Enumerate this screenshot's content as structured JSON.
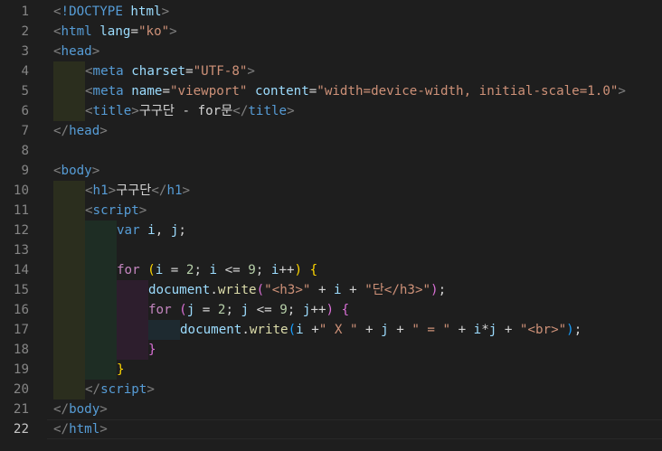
{
  "editor": {
    "colors": {
      "background": "#1e1e1e",
      "guide_level1": "#2b2e1e",
      "guide_level2": "#1e2d24",
      "guide_level3": "#2d1e2d",
      "guide_level4": "#1e2a30"
    },
    "current_line": 22,
    "lines": [
      {
        "n": "1",
        "indent": [],
        "tokens": [
          [
            "bracket",
            "<"
          ],
          [
            "doctype",
            "!DOCTYPE "
          ],
          [
            "attr",
            "html"
          ],
          [
            "bracket",
            ">"
          ]
        ]
      },
      {
        "n": "2",
        "indent": [],
        "tokens": [
          [
            "bracket",
            "<"
          ],
          [
            "tag",
            "html "
          ],
          [
            "attr",
            "lang"
          ],
          [
            "text",
            "="
          ],
          [
            "str",
            "\"ko\""
          ],
          [
            "bracket",
            ">"
          ]
        ]
      },
      {
        "n": "3",
        "indent": [],
        "tokens": [
          [
            "bracket",
            "<"
          ],
          [
            "tag",
            "head"
          ],
          [
            "bracket",
            ">"
          ]
        ]
      },
      {
        "n": "4",
        "indent": [
          1
        ],
        "tokens": [
          [
            "bracket",
            "<"
          ],
          [
            "tag",
            "meta "
          ],
          [
            "attr",
            "charset"
          ],
          [
            "text",
            "="
          ],
          [
            "str",
            "\"UTF-8\""
          ],
          [
            "bracket",
            ">"
          ]
        ]
      },
      {
        "n": "5",
        "indent": [
          1
        ],
        "tokens": [
          [
            "bracket",
            "<"
          ],
          [
            "tag",
            "meta "
          ],
          [
            "attr",
            "name"
          ],
          [
            "text",
            "="
          ],
          [
            "str",
            "\"viewport\" "
          ],
          [
            "attr",
            "content"
          ],
          [
            "text",
            "="
          ],
          [
            "str",
            "\"width=device-width, initial-scale=1.0\""
          ],
          [
            "bracket",
            ">"
          ]
        ]
      },
      {
        "n": "6",
        "indent": [
          1
        ],
        "tokens": [
          [
            "bracket",
            "<"
          ],
          [
            "tag",
            "title"
          ],
          [
            "bracket",
            ">"
          ],
          [
            "text",
            "구구단 - for문"
          ],
          [
            "bracket",
            "</"
          ],
          [
            "tag",
            "title"
          ],
          [
            "bracket",
            ">"
          ]
        ]
      },
      {
        "n": "7",
        "indent": [],
        "tokens": [
          [
            "bracket",
            "</"
          ],
          [
            "tag",
            "head"
          ],
          [
            "bracket",
            ">"
          ]
        ]
      },
      {
        "n": "8",
        "indent": [],
        "tokens": []
      },
      {
        "n": "9",
        "indent": [],
        "tokens": [
          [
            "bracket",
            "<"
          ],
          [
            "tag",
            "body"
          ],
          [
            "bracket",
            ">"
          ]
        ]
      },
      {
        "n": "10",
        "indent": [
          1
        ],
        "tokens": [
          [
            "bracket",
            "<"
          ],
          [
            "tag",
            "h1"
          ],
          [
            "bracket",
            ">"
          ],
          [
            "text",
            "구구단"
          ],
          [
            "bracket",
            "</"
          ],
          [
            "tag",
            "h1"
          ],
          [
            "bracket",
            ">"
          ]
        ]
      },
      {
        "n": "11",
        "indent": [
          1
        ],
        "tokens": [
          [
            "bracket",
            "<"
          ],
          [
            "tag",
            "script"
          ],
          [
            "bracket",
            ">"
          ]
        ]
      },
      {
        "n": "12",
        "indent": [
          1,
          2
        ],
        "tokens": [
          [
            "kw",
            "var "
          ],
          [
            "var",
            "i"
          ],
          [
            "punc",
            ", "
          ],
          [
            "var",
            "j"
          ],
          [
            "punc",
            ";"
          ]
        ]
      },
      {
        "n": "13",
        "indent": [
          1,
          2
        ],
        "tokens": []
      },
      {
        "n": "14",
        "indent": [
          1,
          2
        ],
        "tokens": [
          [
            "ctrl",
            "for "
          ],
          [
            "p1",
            "("
          ],
          [
            "var",
            "i"
          ],
          [
            "op",
            " = "
          ],
          [
            "num",
            "2"
          ],
          [
            "punc",
            "; "
          ],
          [
            "var",
            "i"
          ],
          [
            "op",
            " <= "
          ],
          [
            "num",
            "9"
          ],
          [
            "punc",
            "; "
          ],
          [
            "var",
            "i"
          ],
          [
            "op",
            "++"
          ],
          [
            "p1",
            ")"
          ],
          [
            "punc",
            " "
          ],
          [
            "p1",
            "{"
          ]
        ]
      },
      {
        "n": "15",
        "indent": [
          1,
          2,
          3
        ],
        "tokens": [
          [
            "var",
            "document"
          ],
          [
            "punc",
            "."
          ],
          [
            "fn",
            "write"
          ],
          [
            "p2",
            "("
          ],
          [
            "str",
            "\"<h3>\""
          ],
          [
            "op",
            " + "
          ],
          [
            "var",
            "i"
          ],
          [
            "op",
            " + "
          ],
          [
            "str",
            "\"단</h3>\""
          ],
          [
            "p2",
            ")"
          ],
          [
            "punc",
            ";"
          ]
        ]
      },
      {
        "n": "16",
        "indent": [
          1,
          2,
          3
        ],
        "tokens": [
          [
            "ctrl",
            "for "
          ],
          [
            "p2",
            "("
          ],
          [
            "var",
            "j"
          ],
          [
            "op",
            " = "
          ],
          [
            "num",
            "2"
          ],
          [
            "punc",
            "; "
          ],
          [
            "var",
            "j"
          ],
          [
            "op",
            " <= "
          ],
          [
            "num",
            "9"
          ],
          [
            "punc",
            "; "
          ],
          [
            "var",
            "j"
          ],
          [
            "op",
            "++"
          ],
          [
            "p2",
            ")"
          ],
          [
            "punc",
            " "
          ],
          [
            "p2",
            "{"
          ]
        ]
      },
      {
        "n": "17",
        "indent": [
          1,
          2,
          3,
          4
        ],
        "tokens": [
          [
            "var",
            "document"
          ],
          [
            "punc",
            "."
          ],
          [
            "fn",
            "write"
          ],
          [
            "p3",
            "("
          ],
          [
            "var",
            "i"
          ],
          [
            "op",
            " +"
          ],
          [
            "str",
            "\" X \""
          ],
          [
            "op",
            " + "
          ],
          [
            "var",
            "j"
          ],
          [
            "op",
            " + "
          ],
          [
            "str",
            "\" = \""
          ],
          [
            "op",
            " + "
          ],
          [
            "var",
            "i"
          ],
          [
            "op",
            "*"
          ],
          [
            "var",
            "j"
          ],
          [
            "op",
            " + "
          ],
          [
            "str",
            "\"<br>\""
          ],
          [
            "p3",
            ")"
          ],
          [
            "punc",
            ";"
          ]
        ]
      },
      {
        "n": "18",
        "indent": [
          1,
          2,
          3
        ],
        "tokens": [
          [
            "p2",
            "}"
          ]
        ]
      },
      {
        "n": "19",
        "indent": [
          1,
          2
        ],
        "tokens": [
          [
            "p1",
            "}"
          ]
        ]
      },
      {
        "n": "20",
        "indent": [
          1
        ],
        "tokens": [
          [
            "bracket",
            "</"
          ],
          [
            "tag",
            "script"
          ],
          [
            "bracket",
            ">"
          ]
        ]
      },
      {
        "n": "21",
        "indent": [],
        "tokens": [
          [
            "bracket",
            "</"
          ],
          [
            "tag",
            "body"
          ],
          [
            "bracket",
            ">"
          ]
        ]
      },
      {
        "n": "22",
        "indent": [],
        "tokens": [
          [
            "bracket",
            "</"
          ],
          [
            "tag",
            "html"
          ],
          [
            "bracket",
            ">"
          ]
        ]
      }
    ]
  }
}
